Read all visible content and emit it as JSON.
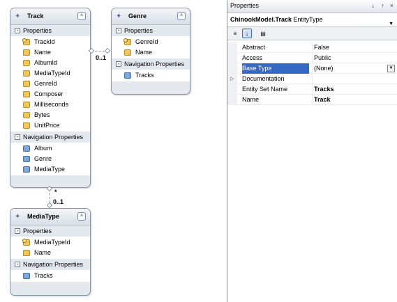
{
  "diagram": {
    "entities": {
      "track": {
        "title": "Track",
        "properties_label": "Properties",
        "properties": [
          "TrackId",
          "Name",
          "AlbumId",
          "MediaTypeId",
          "GenreId",
          "Composer",
          "Milliseconds",
          "Bytes",
          "UnitPrice"
        ],
        "nav_label": "Navigation Properties",
        "nav": [
          "Album",
          "Genre",
          "MediaType"
        ]
      },
      "genre": {
        "title": "Genre",
        "properties_label": "Properties",
        "properties": [
          "GenreId",
          "Name"
        ],
        "nav_label": "Navigation Properties",
        "nav": [
          "Tracks"
        ]
      },
      "mediatype": {
        "title": "MediaType",
        "properties_label": "Properties",
        "properties": [
          "MediaTypeId",
          "Name"
        ],
        "nav_label": "Navigation Properties",
        "nav": [
          "Tracks"
        ]
      }
    },
    "multiplicity": {
      "genre_zero_one": "0..1",
      "mediatype_many": "*",
      "mediatype_zero_one": "0..1"
    }
  },
  "properties_panel": {
    "title": "Properties",
    "pin": "↓",
    "pin2": "↑",
    "close": "×",
    "object_name": "ChinookModel.Track",
    "object_type": "EntityType",
    "rows": [
      {
        "name": "Abstract",
        "value": "False",
        "bold": false,
        "expander": ""
      },
      {
        "name": "Access",
        "value": "Public",
        "bold": false,
        "expander": ""
      },
      {
        "name": "Base Type",
        "value": "(None)",
        "bold": false,
        "expander": ""
      },
      {
        "name": "Documentation",
        "value": "",
        "bold": false,
        "expander": "▷"
      },
      {
        "name": "Entity Set Name",
        "value": "Tracks",
        "bold": true,
        "expander": ""
      },
      {
        "name": "Name",
        "value": "Track",
        "bold": true,
        "expander": ""
      }
    ]
  }
}
